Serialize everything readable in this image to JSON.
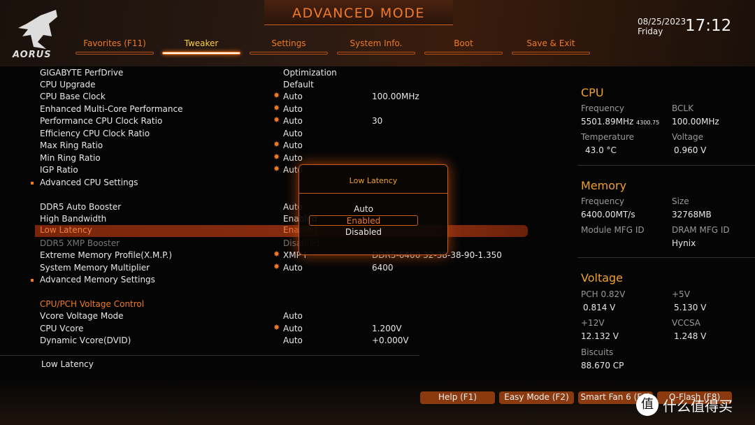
{
  "header": {
    "title": "ADVANCED MODE",
    "logo": "AORUS",
    "date": "08/25/2023",
    "day": "Friday",
    "time": "17:12"
  },
  "tabs": [
    {
      "label": "Favorites (F11)"
    },
    {
      "label": "Tweaker",
      "active": true
    },
    {
      "label": "Settings"
    },
    {
      "label": "System Info."
    },
    {
      "label": "Boot"
    },
    {
      "label": "Save & Exit"
    }
  ],
  "settings": [
    {
      "label": "GIGABYTE PerfDrive",
      "value": "Optimization"
    },
    {
      "label": "CPU Upgrade",
      "value": "Default"
    },
    {
      "label": "CPU Base Clock",
      "star": true,
      "value": "Auto",
      "extra": "100.00MHz"
    },
    {
      "label": "Enhanced Multi-Core Performance",
      "star": true,
      "value": "Auto"
    },
    {
      "label": "Performance CPU Clock Ratio",
      "star": true,
      "value": "Auto",
      "extra": "30"
    },
    {
      "label": "Efficiency CPU Clock Ratio",
      "value": "Auto"
    },
    {
      "label": "Max Ring Ratio",
      "star": true,
      "value": "Auto"
    },
    {
      "label": "Min Ring Ratio",
      "star": true,
      "value": "Auto"
    },
    {
      "label": "IGP Ratio",
      "star": true,
      "value": "Auto"
    },
    {
      "label": "Advanced CPU Settings",
      "submenu": true
    },
    {
      "label": "DDR5 Auto Booster",
      "value": "Auto"
    },
    {
      "label": "High Bandwidth",
      "value": "Enabled"
    },
    {
      "label": "Low Latency",
      "value": "Enabled",
      "selected": true
    },
    {
      "label": "DDR5 XMP Booster",
      "value": "Disabled",
      "disabled": true
    },
    {
      "label": "Extreme Memory Profile(X.M.P.)",
      "star": true,
      "value": "XMP I",
      "extra": "DDR5-6400 32-38-38-90-1.350"
    },
    {
      "label": "System Memory Multiplier",
      "star": true,
      "value": "Auto",
      "extra": "6400"
    },
    {
      "label": "Advanced Memory Settings",
      "submenu": true
    },
    {
      "label": "CPU/PCH Voltage Control",
      "heading": true
    },
    {
      "label": "Vcore Voltage Mode",
      "value": "Auto"
    },
    {
      "label": "CPU Vcore",
      "star": true,
      "value": "Auto",
      "extra": "1.200V"
    },
    {
      "label": "Dynamic Vcore(DVID)",
      "value": "Auto",
      "extra": "+0.000V"
    }
  ],
  "help_text": "Low Latency",
  "popup": {
    "title": "Low Latency",
    "options": [
      "Auto",
      "Enabled",
      "Disabled"
    ],
    "selected": "Enabled"
  },
  "cpu": {
    "title": "CPU",
    "freq_label": "Frequency",
    "freq": "5501.89MHz",
    "freq_sub": "4300.75",
    "bclk_label": "BCLK",
    "bclk": "100.00MHz",
    "temp_label": "Temperature",
    "temp": "43.0 °C",
    "volt_label": "Voltage",
    "volt": "0.960 V"
  },
  "memory": {
    "title": "Memory",
    "freq_label": "Frequency",
    "freq": "6400.00MT/s",
    "size_label": "Size",
    "size": "32768MB",
    "module_label": "Module MFG ID",
    "dram_label": "DRAM MFG ID",
    "dram": "Hynix"
  },
  "voltage": {
    "title": "Voltage",
    "pch_label": "PCH 0.82V",
    "pch": "0.814 V",
    "v5_label": "+5V",
    "v5": "5.130 V",
    "v12_label": "+12V",
    "v12": "12.132 V",
    "vccsa_label": "VCCSA",
    "vccsa": "1.248 V",
    "biscuits_label": "Biscuits",
    "biscuits": "88.670 CP"
  },
  "buttons": [
    "Help (F1)",
    "Easy Mode (F2)",
    "Smart Fan 6 (F6)",
    "Q-Flash (F8)"
  ],
  "watermark": {
    "icon": "值",
    "text": "什么值得买"
  },
  "colors": {
    "accent": "#f07a22",
    "active_tab": "#ffd23a",
    "highlight": "#7a250a"
  }
}
